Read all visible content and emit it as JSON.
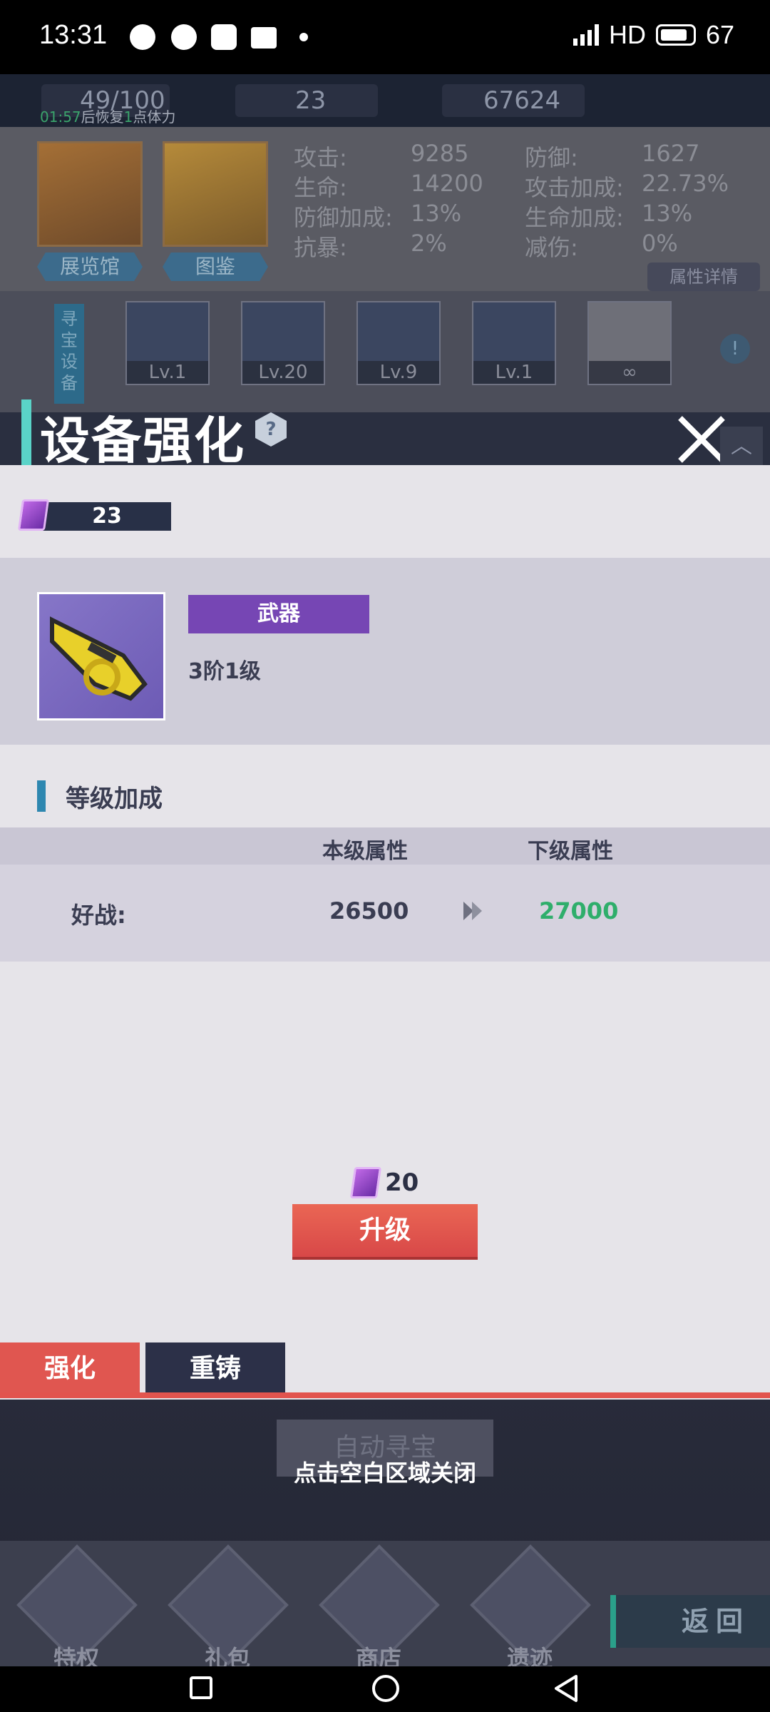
{
  "status_bar": {
    "time": "13:31",
    "network": "HD",
    "battery": "67"
  },
  "game": {
    "resources": {
      "stamina": "49/100",
      "gems": "23",
      "gold": "67624",
      "recover_time": "01:57",
      "recover_text_1": "后恢复",
      "recover_amount": "1",
      "recover_text_2": "点体力"
    },
    "cards": [
      "展览馆",
      "图鉴"
    ],
    "stats": [
      {
        "label": "攻击:",
        "value": "9285"
      },
      {
        "label": "防御:",
        "value": "1627"
      },
      {
        "label": "生命:",
        "value": "14200"
      },
      {
        "label": "攻击加成:",
        "value": "22.73%"
      },
      {
        "label": "防御加成:",
        "value": "13%"
      },
      {
        "label": "生命加成:",
        "value": "13%"
      },
      {
        "label": "抗暴:",
        "value": "2%"
      },
      {
        "label": "减伤:",
        "value": "0%"
      }
    ],
    "detail_button": "属性详情",
    "equip_tab": "寻宝设备",
    "equipment": [
      {
        "level": "Lv.1"
      },
      {
        "level": "Lv.20"
      },
      {
        "level": "Lv.9"
      },
      {
        "level": "Lv.1"
      },
      {
        "level": "∞"
      }
    ],
    "auto_button": "自动寻宝",
    "nav": [
      "特权",
      "礼包",
      "商店",
      "遗迹"
    ],
    "back_button": "返回"
  },
  "dialog": {
    "title": "设备强化",
    "help": "?",
    "currency_amount": "23",
    "item": {
      "type": "武器",
      "level": "3阶1级"
    },
    "section_title": "等级加成",
    "columns": {
      "current": "本级属性",
      "next": "下级属性"
    },
    "attribute": {
      "name": "好战:",
      "current": "26500",
      "next": "27000"
    },
    "cost": "20",
    "upgrade_button": "升级",
    "tabs": {
      "enhance": "强化",
      "recast": "重铸"
    },
    "close_hint": "点击空白区域关闭"
  },
  "colors": {
    "accent_red": "#e2544e",
    "purple_badge": "#7646b4",
    "green_value": "#2fae6b",
    "dark_navy": "#283047"
  }
}
